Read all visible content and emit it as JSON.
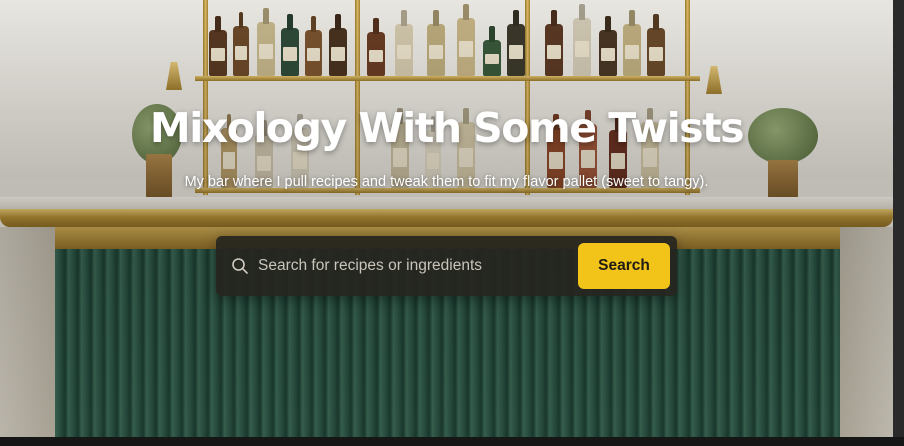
{
  "hero": {
    "title": "Mixology With Some Twists",
    "subtitle": "My bar where I pull recipes and tweak them to fit my flavor pallet (sweet to tangy).",
    "background": "bar-counter-with-bottle-shelves"
  },
  "search": {
    "placeholder": "Search for recipes or ingredients",
    "value": "",
    "button_label": "Search",
    "icon": "search-icon"
  },
  "colors": {
    "accent": "#f2c318",
    "search_box_bg": "#26251f",
    "title_text": "#ffffff"
  }
}
